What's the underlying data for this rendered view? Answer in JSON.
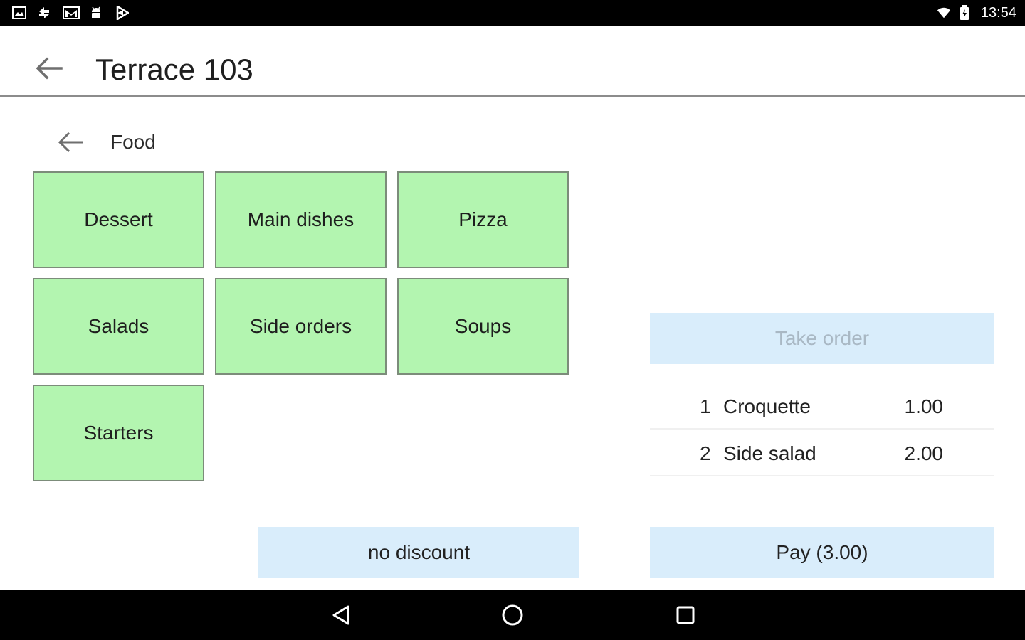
{
  "status_bar": {
    "time": "13:54",
    "notification_icons": [
      "gallery-icon",
      "sync-icon",
      "gmail-icon",
      "android-icon",
      "play-store-icon"
    ],
    "system_icons": [
      "wifi-icon",
      "battery-icon"
    ]
  },
  "header": {
    "title": "Terrace 103",
    "back_icon": "arrow-back-icon"
  },
  "category": {
    "title": "Food",
    "back_icon": "arrow-back-icon",
    "items": [
      {
        "label": "Dessert"
      },
      {
        "label": "Main dishes"
      },
      {
        "label": "Pizza"
      },
      {
        "label": "Salads"
      },
      {
        "label": "Side orders"
      },
      {
        "label": "Soups"
      },
      {
        "label": "Starters"
      }
    ]
  },
  "order": {
    "take_order_label": "Take order",
    "items": [
      {
        "qty": "1",
        "name": "Croquette",
        "price": "1.00"
      },
      {
        "qty": "2",
        "name": "Side salad",
        "price": "2.00"
      }
    ],
    "pay_label": "Pay (3.00)"
  },
  "discount": {
    "label": "no discount"
  },
  "nav_bar": {
    "icons": [
      "back-triangle-icon",
      "home-circle-icon",
      "recents-square-icon"
    ]
  },
  "colors": {
    "tile_bg": "#b3f5b0",
    "button_bg": "#d9edfb",
    "bars_bg": "#000000"
  }
}
